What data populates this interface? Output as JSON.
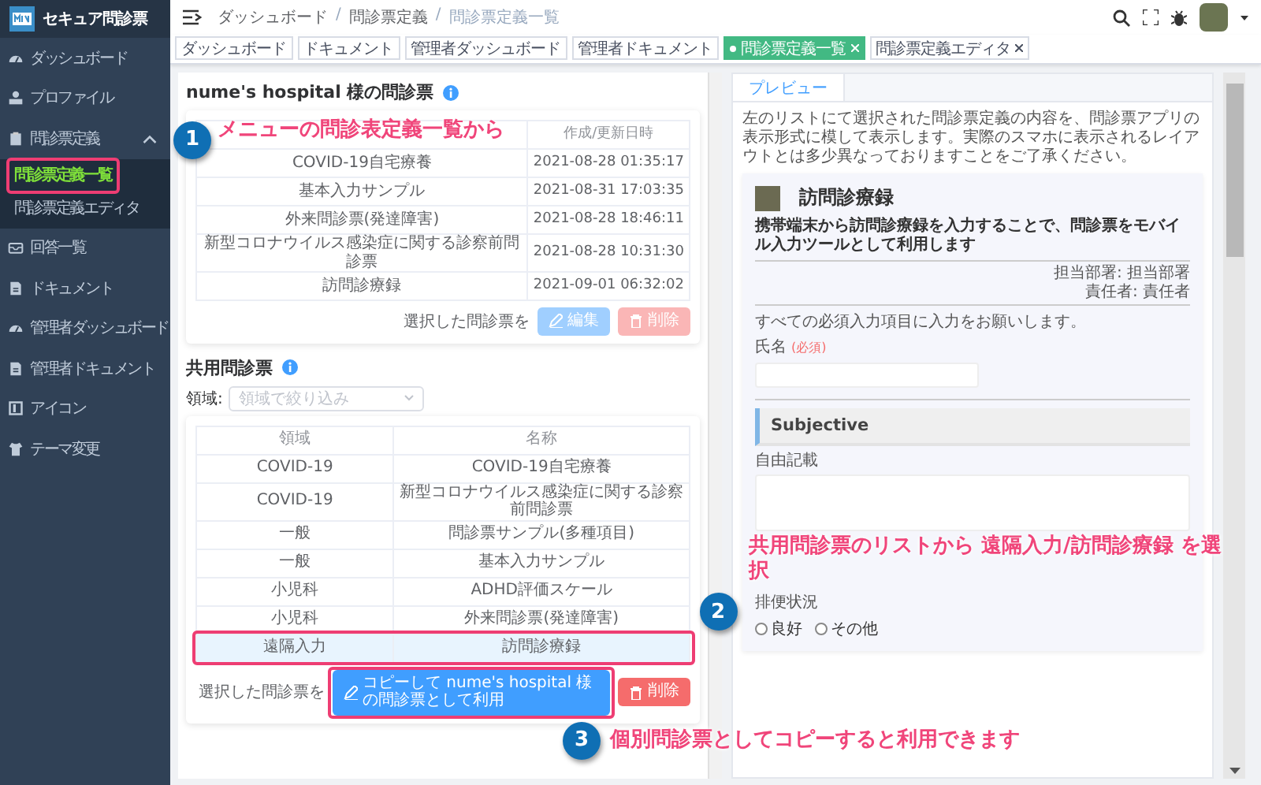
{
  "app": {
    "title": "セキュア問診票"
  },
  "sidebar": {
    "items": [
      {
        "label": "ダッシュボード",
        "selected": false
      },
      {
        "label": "プロファイル",
        "selected": false
      },
      {
        "label": "問診票定義",
        "selected": false,
        "expanded": true,
        "children": [
          {
            "label": "問診票定義一覧",
            "selected": true
          },
          {
            "label": "問診票定義エディタ",
            "selected": false
          }
        ]
      },
      {
        "label": "回答一覧",
        "selected": false
      },
      {
        "label": "ドキュメント",
        "selected": false
      },
      {
        "label": "管理者ダッシュボード",
        "selected": false
      },
      {
        "label": "管理者ドキュメント",
        "selected": false
      },
      {
        "label": "アイコン",
        "selected": false
      },
      {
        "label": "テーマ変更",
        "selected": false
      }
    ]
  },
  "breadcrumb": [
    {
      "kind": "link",
      "text": "ダッシュボード"
    },
    {
      "kind": "separator",
      "text": "/"
    },
    {
      "kind": "link",
      "text": "問診票定義"
    },
    {
      "kind": "separator",
      "text": "/"
    },
    {
      "kind": "current",
      "text": "問診票定義一覧"
    }
  ],
  "tabs": [
    {
      "label": "ダッシュボード",
      "selected": false,
      "closable": false
    },
    {
      "label": "ドキュメント",
      "selected": false,
      "closable": false
    },
    {
      "label": "管理者ダッシュボード",
      "selected": false,
      "closable": false
    },
    {
      "label": "管理者ドキュメント",
      "selected": false,
      "closable": false
    },
    {
      "label": "問診票定義一覧",
      "selected": true,
      "closable": true
    },
    {
      "label": "問診票定義エディタ",
      "selected": false,
      "closable": true
    }
  ],
  "own_forms": {
    "title": "nume's hospital 様の問診票",
    "column_2_header": "作成/更新日時",
    "rows": [
      {
        "name": "COVID-19自宅療養",
        "updated": "2021-08-28 01:35:17",
        "selected": false
      },
      {
        "name": "基本入力サンプル",
        "updated": "2021-08-31 17:03:35",
        "selected": false
      },
      {
        "name": "外来問診票(発達障害)",
        "updated": "2021-08-28 18:46:11",
        "selected": false
      },
      {
        "name": "新型コロナウイルス感染症に関する診察前問診票",
        "updated": "2021-08-28 10:31:30",
        "selected": false
      },
      {
        "name": "訪問診療録",
        "updated": "2021-09-01 06:32:02",
        "selected": false
      }
    ],
    "action_label": "選択した問診票を",
    "buttons": [
      {
        "label": "編集",
        "kind": "edit",
        "disabled": true
      },
      {
        "label": "削除",
        "kind": "delete",
        "disabled": true
      }
    ]
  },
  "shared_forms": {
    "title": "共用問診票",
    "filter": {
      "label": "領域:",
      "placeholder": "領域で絞り込み"
    },
    "columns": [
      "領域",
      "名称"
    ],
    "rows": [
      {
        "area": "COVID-19",
        "name": "COVID-19自宅療養",
        "selected": false
      },
      {
        "area": "COVID-19",
        "name": "新型コロナウイルス感染症に関する診察前問診票",
        "selected": false
      },
      {
        "area": "一般",
        "name": "問診票サンプル(多種項目)",
        "selected": false
      },
      {
        "area": "一般",
        "name": "基本入力サンプル",
        "selected": false
      },
      {
        "area": "小児科",
        "name": "ADHD評価スケール",
        "selected": false
      },
      {
        "area": "小児科",
        "name": "外来問診票(発達障害)",
        "selected": false
      },
      {
        "area": "遠隔入力",
        "name": "訪問診療録",
        "selected": true
      }
    ],
    "action_label": "選択した問診票を",
    "buttons": [
      {
        "label": "コピーして nume's hospital 様の問診票として利用",
        "kind": "edit",
        "disabled": false
      },
      {
        "label": "削除",
        "kind": "delete",
        "disabled": false
      }
    ]
  },
  "preview": {
    "tab": "プレビュー",
    "notice": "左のリストにて選択された問診票定義の内容を、問診票アプリの表示形式に模して表示します。実際のスマホに表示されるレイアウトとは多少異なっておりますことをご了承ください。",
    "form": {
      "title": "訪問診療録",
      "description": "携帯端末から訪問診療録を入力することで、問診票をモバイル入力ツールとして利用します",
      "department": "担当部署: 担当部署",
      "owner": "責任者: 責任者",
      "instruction": "すべての必須入力項目に入力をお願いします。",
      "fields": [
        {
          "kind": "text",
          "label": "氏名",
          "required_label": "(必須)"
        },
        {
          "kind": "section",
          "label": "Subjective"
        },
        {
          "kind": "textarea",
          "label": "自由記載"
        },
        {
          "kind": "gap"
        },
        {
          "kind": "radio",
          "label": "排便状況",
          "options": [
            {
              "label": "良好",
              "checked": false
            },
            {
              "label": "その他",
              "checked": false
            }
          ]
        }
      ]
    }
  },
  "annotations": [
    {
      "number": "1",
      "text": "メニューの問診表定義一覧から"
    },
    {
      "number": "2",
      "text": "共用問診票のリストから 遠隔入力/訪問診療録 を選択"
    },
    {
      "number": "3",
      "text": "個別問診票としてコピーすると利用できます"
    }
  ]
}
